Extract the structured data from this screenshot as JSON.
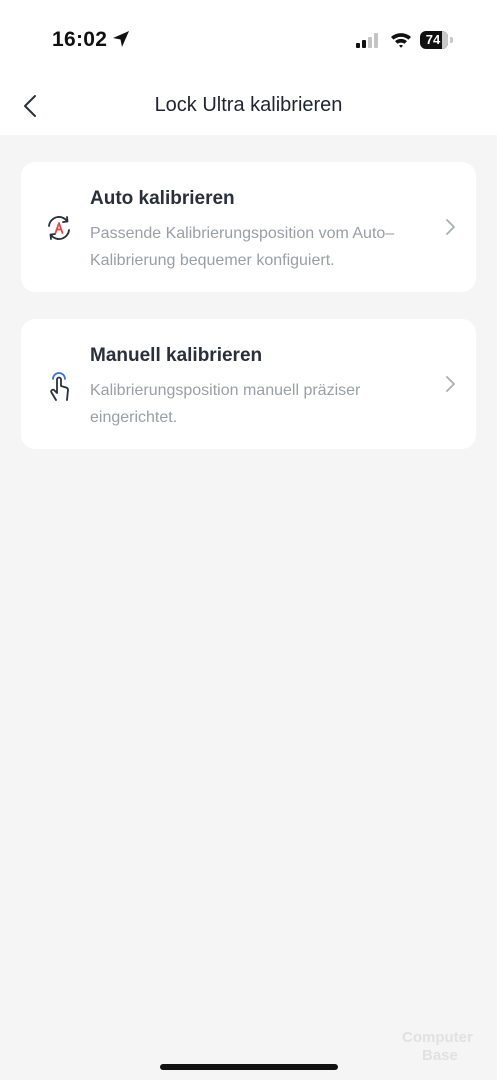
{
  "status": {
    "time": "16:02",
    "battery": "74",
    "icons": [
      "location-arrow-icon",
      "cellular-signal-icon",
      "wifi-icon",
      "battery-icon"
    ]
  },
  "nav": {
    "title": "Lock Ultra kalibrieren",
    "back_icon": "chevron-left-icon"
  },
  "options": [
    {
      "title": "Auto kalibrieren",
      "description": "Passende Kalibrierungsposition vom Auto–Kalibrierung bequemer konfiguiert.",
      "icon": "auto-calibrate-icon",
      "icon_accent": "#e64545"
    },
    {
      "title": "Manuell kalibrieren",
      "description": "Kalibrierungsposition manuell präziser eingerichtet.",
      "icon": "hand-tap-icon",
      "icon_accent": "#3a6fe0"
    }
  ],
  "watermark": {
    "line1": "Computer",
    "line2": "Base"
  },
  "colors": {
    "background": "#f5f5f5",
    "card": "#ffffff",
    "title_text": "#2a2f3a",
    "secondary_text": "#9a9ea6"
  }
}
